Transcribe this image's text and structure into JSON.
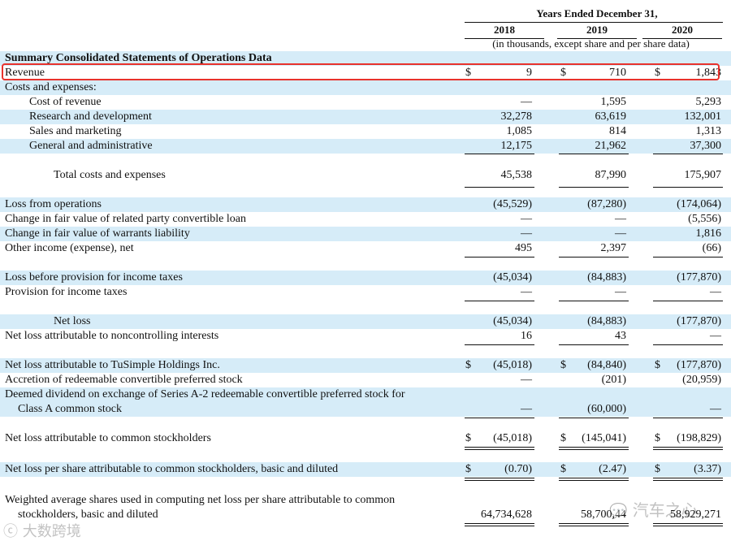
{
  "header": {
    "period": "Years Ended December 31,",
    "years": [
      "2018",
      "2019",
      "2020"
    ],
    "note": "(in thousands, except share and per share data)"
  },
  "section_title": "Summary Consolidated Statements of Operations Data",
  "rows": [
    {
      "label": "Revenue",
      "v": [
        "9",
        "710",
        "1,843"
      ],
      "dollar": true
    },
    {
      "label": "Costs and expenses:",
      "v": [
        "",
        "",
        ""
      ]
    },
    {
      "label": "Cost of revenue",
      "v": [
        "—",
        "1,595",
        "5,293"
      ]
    },
    {
      "label": "Research and development",
      "v": [
        "32,278",
        "63,619",
        "132,001"
      ]
    },
    {
      "label": "Sales and marketing",
      "v": [
        "1,085",
        "814",
        "1,313"
      ]
    },
    {
      "label": "General and administrative",
      "v": [
        "12,175",
        "21,962",
        "37,300"
      ]
    },
    {
      "label": "Total costs and expenses",
      "v": [
        "45,538",
        "87,990",
        "175,907"
      ]
    },
    {
      "label": "Loss from operations",
      "v": [
        "(45,529)",
        "(87,280)",
        "(174,064)"
      ]
    },
    {
      "label": "Change in fair value of related party convertible loan",
      "v": [
        "—",
        "—",
        "(5,556)"
      ]
    },
    {
      "label": "Change in fair value of warrants liability",
      "v": [
        "—",
        "—",
        "1,816"
      ]
    },
    {
      "label": "Other income (expense), net",
      "v": [
        "495",
        "2,397",
        "(66)"
      ]
    },
    {
      "label": "Loss before provision for income taxes",
      "v": [
        "(45,034)",
        "(84,883)",
        "(177,870)"
      ]
    },
    {
      "label": "Provision for income taxes",
      "v": [
        "—",
        "—",
        "—"
      ]
    },
    {
      "label": "Net loss",
      "v": [
        "(45,034)",
        "(84,883)",
        "(177,870)"
      ]
    },
    {
      "label": "Net loss attributable to noncontrolling interests",
      "v": [
        "16",
        "43",
        "—"
      ]
    },
    {
      "label": "Net loss attributable to TuSimple Holdings Inc.",
      "v": [
        "(45,018)",
        "(84,840)",
        "(177,870)"
      ],
      "dollar": true
    },
    {
      "label": "Accretion of redeemable convertible preferred stock",
      "v": [
        "—",
        "(201)",
        "(20,959)"
      ]
    },
    {
      "label": "Deemed dividend on exchange of Series A-2 redeemable convertible preferred stock for",
      "v": [
        "",
        "",
        ""
      ]
    },
    {
      "label": "Class A common stock",
      "v": [
        "—",
        "(60,000)",
        "—"
      ]
    },
    {
      "label": "Net loss attributable to common stockholders",
      "v": [
        "(45,018)",
        "(145,041)",
        "(198,829)"
      ],
      "dollar": true
    },
    {
      "label": "Net loss per share attributable to common stockholders, basic and diluted",
      "v": [
        "(0.70)",
        "(2.47)",
        "(3.37)"
      ],
      "dollar": true
    },
    {
      "label": "Weighted average shares used in computing net loss per share attributable to common",
      "v": [
        "",
        "",
        ""
      ]
    },
    {
      "label": "stockholders, basic and diluted",
      "v": [
        "64,734,628",
        "58,700,44",
        "58,929,271"
      ]
    }
  ],
  "dollar_sign": "$",
  "watermarks": {
    "right": "汽车之心",
    "left": "大数跨境"
  }
}
